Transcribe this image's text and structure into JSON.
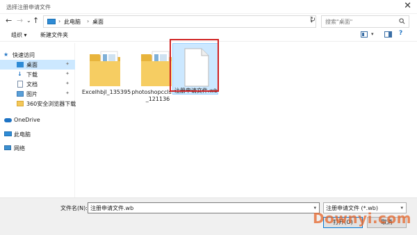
{
  "window": {
    "title": "选择注册申请文件",
    "close_label": "✕"
  },
  "nav": {
    "back": "←",
    "forward": "→",
    "recent": "⌄",
    "up": "↑",
    "breadcrumb": [
      "此电脑",
      "桌面"
    ],
    "separator": "›",
    "refresh": "↻",
    "search_placeholder": "搜索\"桌面\""
  },
  "toolbar": {
    "organize": "组织 ▾",
    "new_folder": "新建文件夹"
  },
  "sidebar": {
    "items": [
      {
        "label": "快速访问",
        "icon": "star-icon"
      },
      {
        "label": "桌面",
        "icon": "desktop-icon",
        "pinned": true
      },
      {
        "label": "下载",
        "icon": "download-icon",
        "pinned": true
      },
      {
        "label": "文档",
        "icon": "document-icon",
        "pinned": true
      },
      {
        "label": "图片",
        "icon": "picture-icon",
        "pinned": true
      },
      {
        "label": "360安全浏览器下载",
        "icon": "folder-icon"
      },
      {
        "label": "OneDrive",
        "icon": "cloud-icon"
      },
      {
        "label": "此电脑",
        "icon": "computer-icon"
      },
      {
        "label": "网络",
        "icon": "network-icon"
      }
    ]
  },
  "files": [
    {
      "name": "Excelhbjl_135395",
      "type": "folder"
    },
    {
      "name": "photoshopccls b64_121136",
      "type": "folder"
    },
    {
      "name": "注册申请文件.wb",
      "type": "file"
    }
  ],
  "bottom": {
    "filename_label": "文件名(N):",
    "filename_value": "注册申请文件.wb",
    "filter_value": "注册申请文件 (*.wb)",
    "open_button": "打开(O)",
    "cancel_button": "取消"
  },
  "watermark": "Downyi.com",
  "colors": {
    "selection": "#cce8ff",
    "highlight_box": "#d02020",
    "folder": "#f4c85a"
  }
}
